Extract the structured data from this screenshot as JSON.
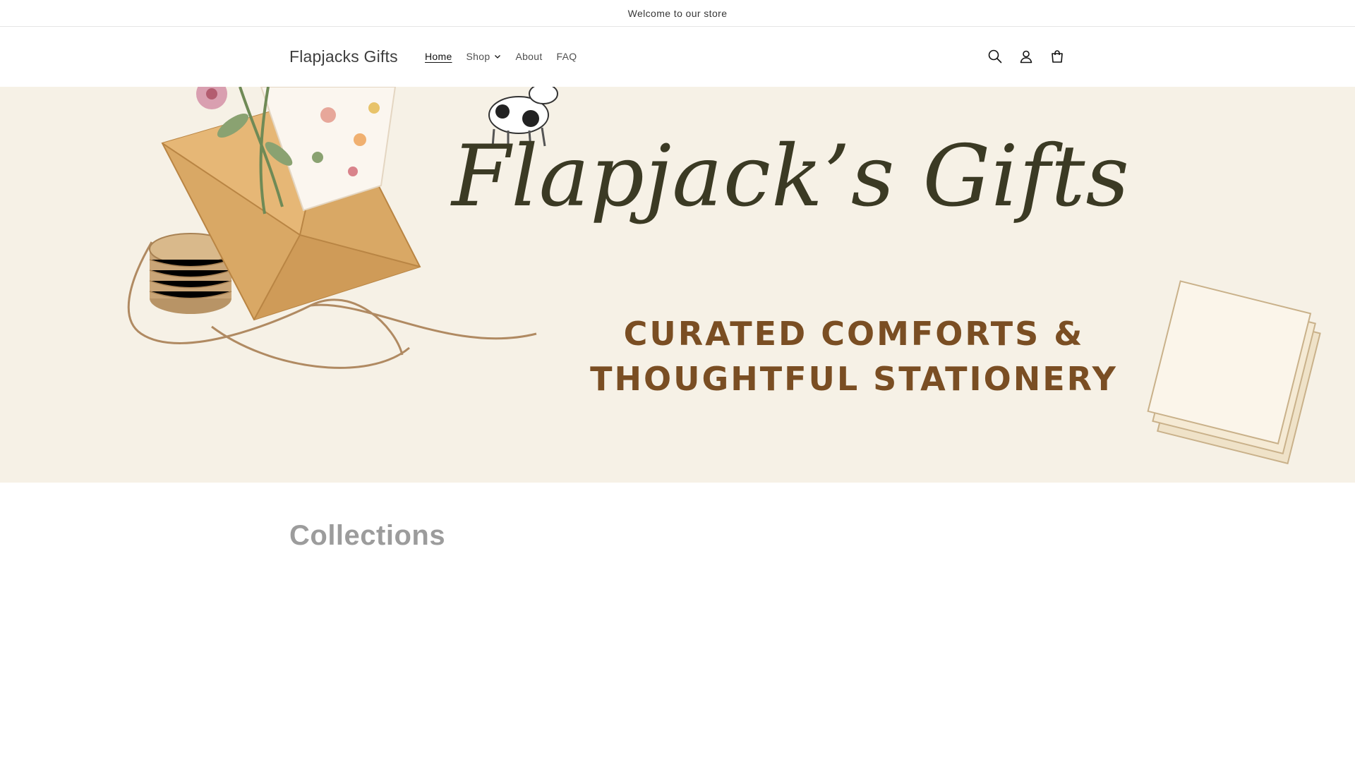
{
  "announcement": {
    "text": "Welcome to our store"
  },
  "header": {
    "logo": "Flapjacks Gifts",
    "nav": [
      {
        "label": "Home",
        "active": true
      },
      {
        "label": "Shop",
        "has_dropdown": true
      },
      {
        "label": "About"
      },
      {
        "label": "FAQ"
      }
    ],
    "icons": [
      "search-icon",
      "account-icon",
      "cart-icon"
    ]
  },
  "banner": {
    "title": "Flapjack’s Gifts",
    "subtitle_line1": "CURATED COMFORTS &",
    "subtitle_line2": "THOUGHTFUL STATIONERY"
  },
  "collections": {
    "heading": "Collections"
  },
  "colors": {
    "banner_bg": "#f6f1e6",
    "title": "#3b3a24",
    "subtitle": "#7a4e23",
    "envelope": "#d9a865"
  }
}
